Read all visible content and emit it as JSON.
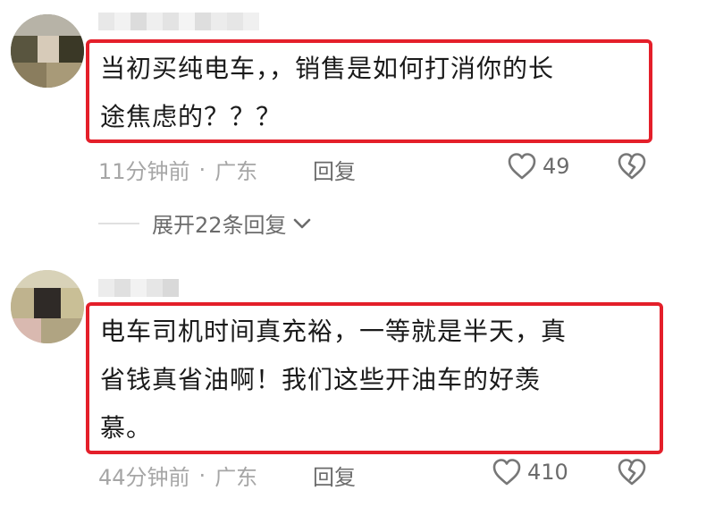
{
  "comments": [
    {
      "text": "当初买纯电车，，销售是如何打消你的长\n途焦虑的？？？",
      "time": "11分钟前",
      "separator": "·",
      "location": "广东",
      "reply_label": "回复",
      "likes": "49"
    },
    {
      "text": "电车司机时间真充裕，一等就是半天，真\n省钱真省油啊！我们这些开油车的好羡\n慕。",
      "time": "44分钟前",
      "separator": "·",
      "location": "广东",
      "reply_label": "回复",
      "likes": "410"
    }
  ],
  "expand_replies": {
    "label": "展开22条回复"
  },
  "colors": {
    "highlight_border": "#e41f2a",
    "meta_text": "#a6a6a6",
    "action_text": "#6b6b6b",
    "body_text": "#1a1a1a"
  },
  "icons": {
    "like": "heart-outline-icon",
    "dislike": "broken-heart-icon",
    "expand": "chevron-down-icon"
  }
}
